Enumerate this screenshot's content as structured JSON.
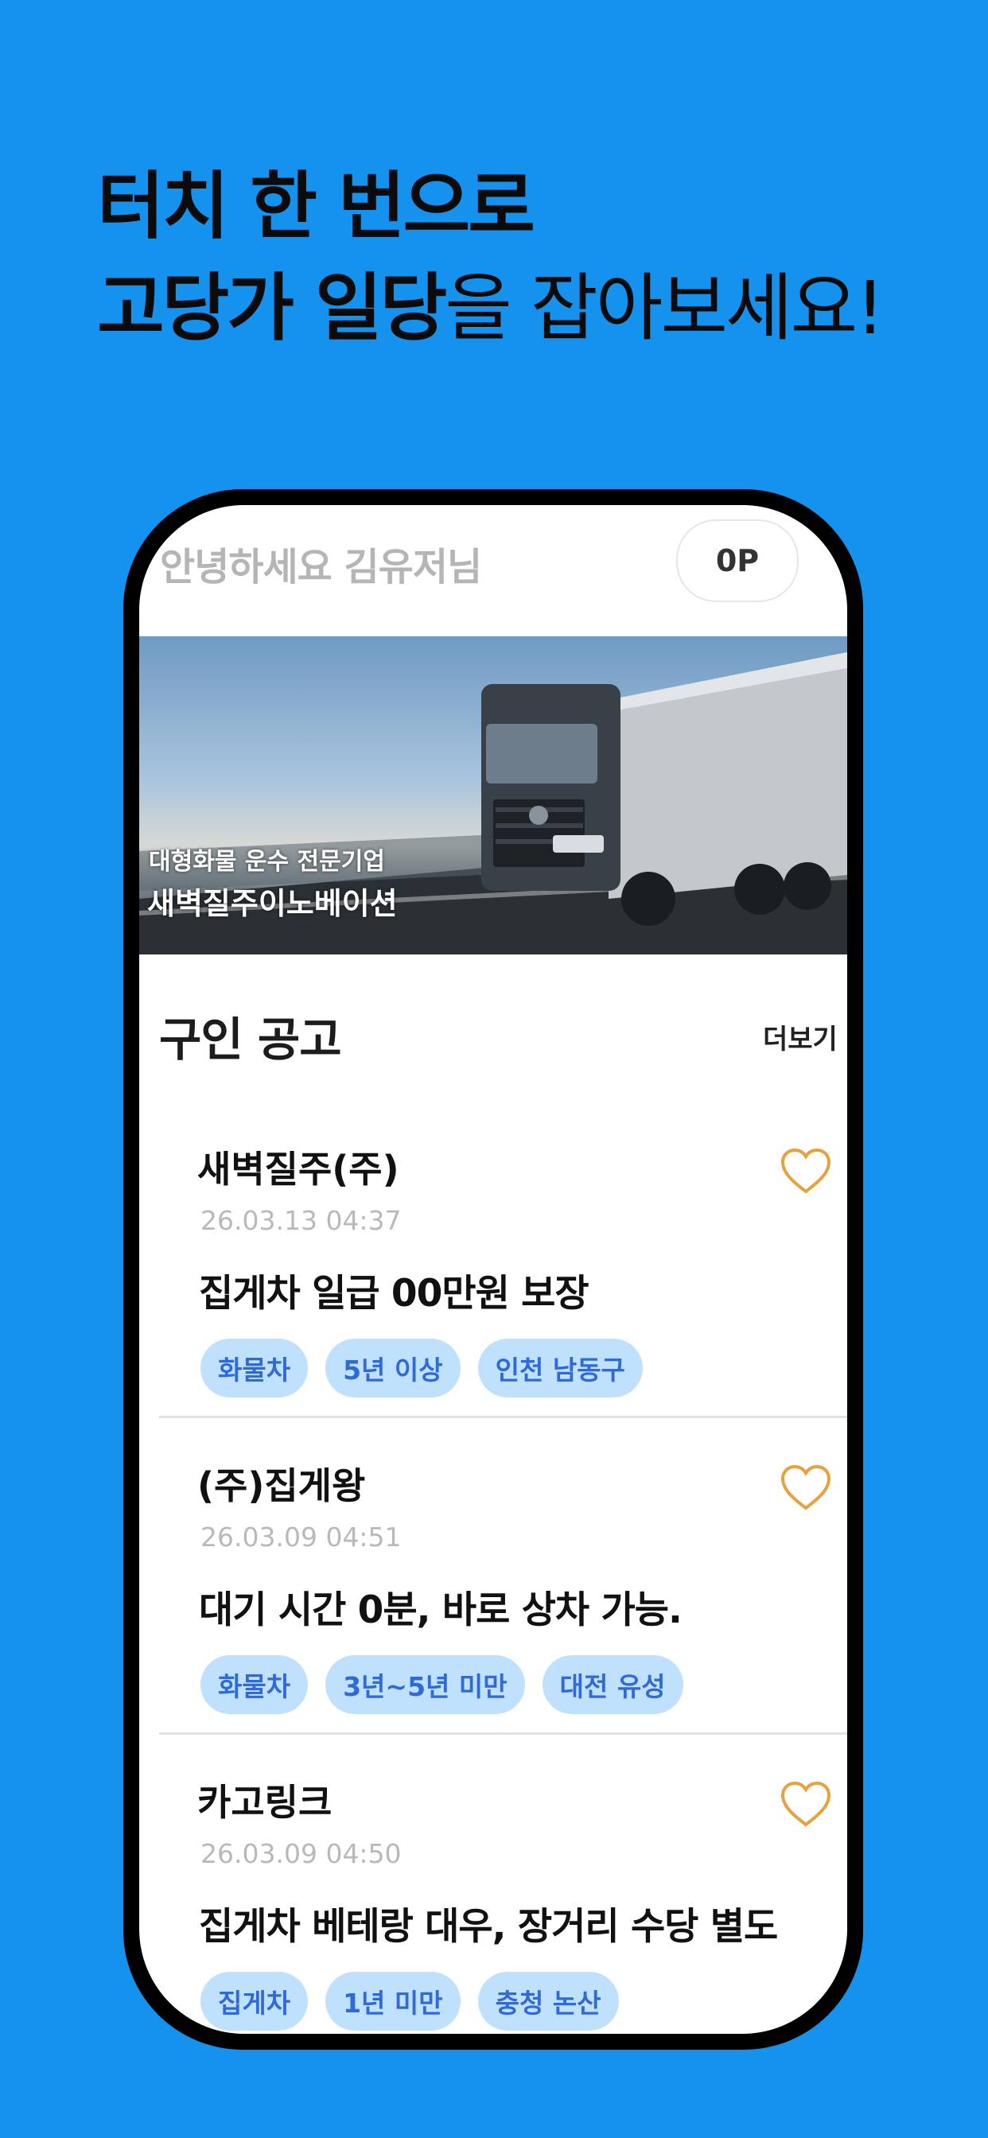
{
  "headline": {
    "line1": "터치 한 번으로",
    "line2_bold": "고당가 일당",
    "line2_rest": "을 잡아보세요!"
  },
  "app": {
    "greeting": "안녕하세요 김유저님",
    "points": "0P",
    "banner": {
      "subtitle": "대형화물 운수 전문기업",
      "title": "새벽질주이노베이션"
    },
    "section": {
      "title": "구인 공고",
      "more": "더보기"
    },
    "jobs": [
      {
        "company": "새벽질주(주)",
        "date": "26.03.13 04:37",
        "title": "집게차 일급 00만원 보장",
        "tags": [
          "화물차",
          "5년 이상",
          "인천 남동구"
        ]
      },
      {
        "company": "(주)집게왕",
        "date": "26.03.09 04:51",
        "title": "대기 시간 0분, 바로 상차 가능.",
        "tags": [
          "화물차",
          "3년~5년 미만",
          "대전 유성"
        ]
      },
      {
        "company": "카고링크",
        "date": "26.03.09 04:50",
        "title": "집게차 베테랑 대우, 장거리 수당 별도",
        "tags": [
          "집게차",
          "1년 미만",
          "충청 논산"
        ]
      }
    ]
  },
  "colors": {
    "background": "#1592ee",
    "tag_bg": "#bfe1fd",
    "tag_text": "#2f6ad6",
    "heart": "#e6a23c"
  },
  "icons": {
    "favorite": "heart-outline-icon"
  }
}
